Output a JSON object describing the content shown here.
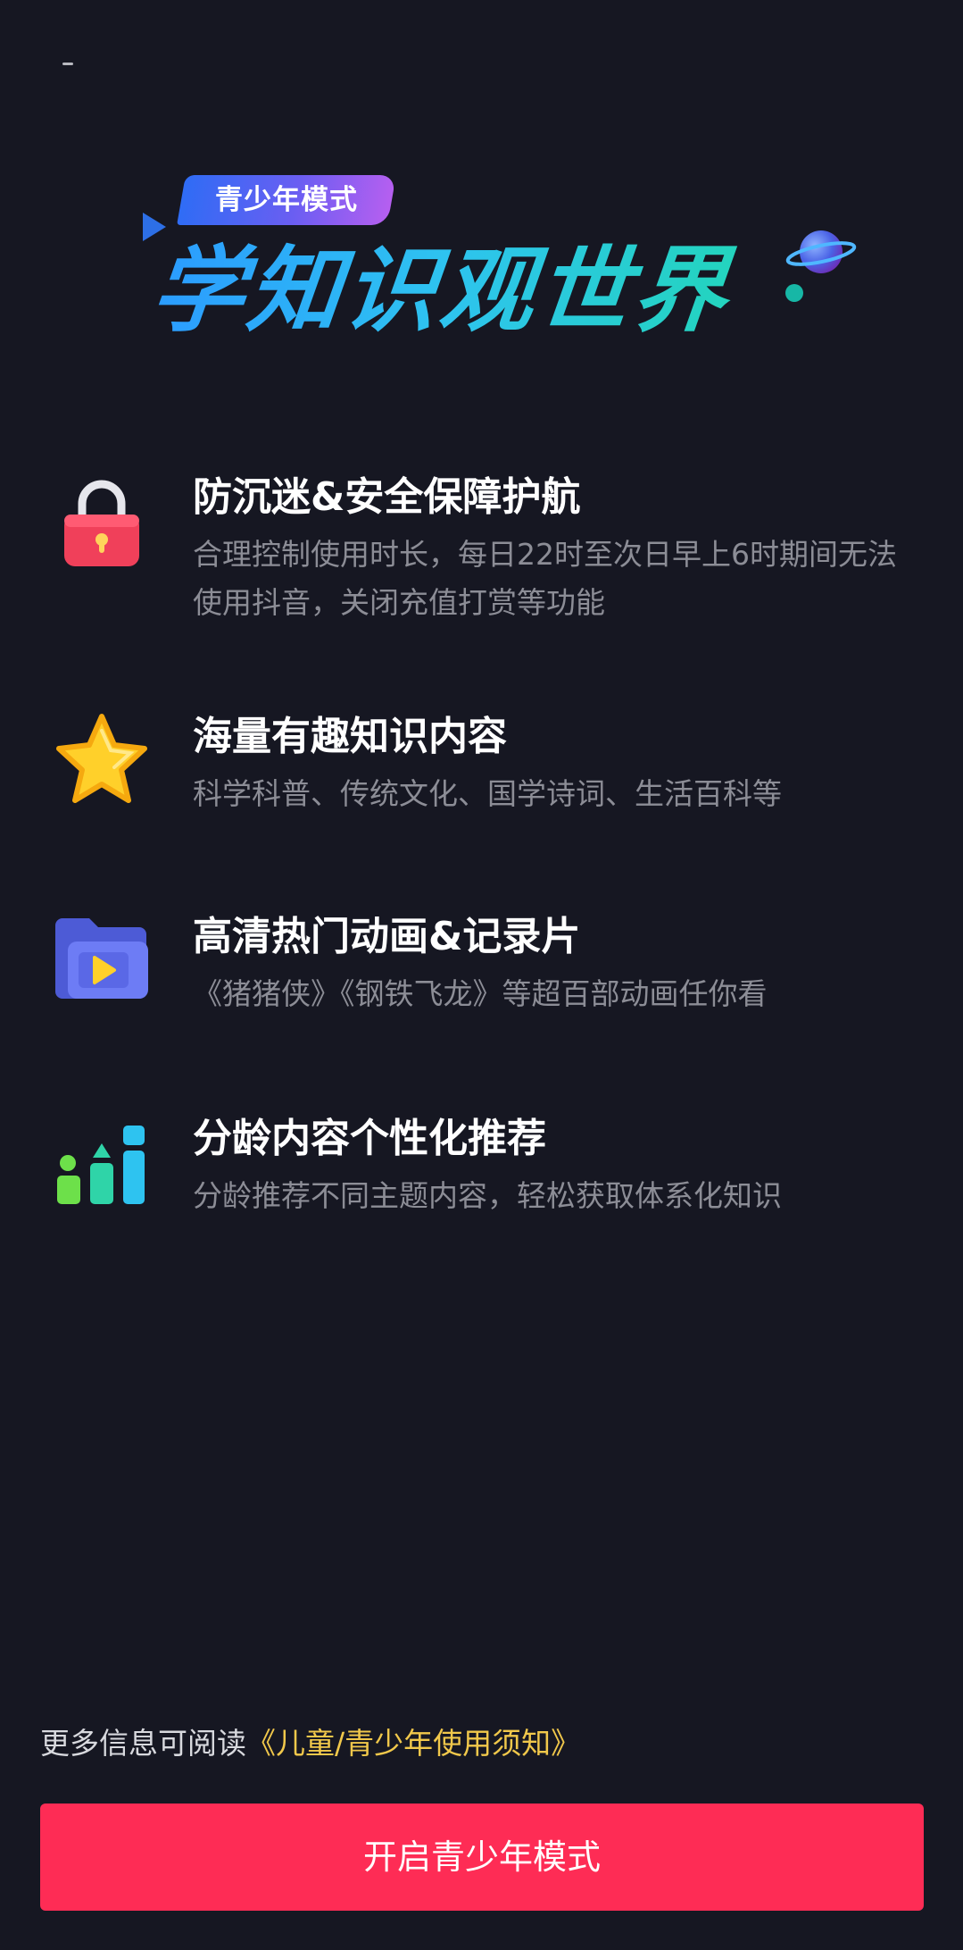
{
  "hero": {
    "badge": "青少年模式",
    "title": "学知识观世界"
  },
  "features": [
    {
      "icon": "lock-icon",
      "title": "防沉迷&安全保障护航",
      "desc": "合理控制使用时长，每日22时至次日早上6时期间无法使用抖音，关闭充值打赏等功能"
    },
    {
      "icon": "star-icon",
      "title": "海量有趣知识内容",
      "desc": "科学科普、传统文化、国学诗词、生活百科等"
    },
    {
      "icon": "video-folder-icon",
      "title": "高清热门动画&记录片",
      "desc": "《猪猪侠》《钢铁飞龙》等超百部动画任你看"
    },
    {
      "icon": "bar-chart-icon",
      "title": "分龄内容个性化推荐",
      "desc": "分龄推荐不同主题内容，轻松获取体系化知识"
    }
  ],
  "footer": {
    "notice_prefix": "更多信息可阅读",
    "notice_link": "《儿童/青少年使用须知》",
    "button_label": "开启青少年模式"
  },
  "colors": {
    "background": "#161722",
    "primary": "#fe2c55",
    "link": "#f1c84b",
    "title_gradient_start": "#2b9bff",
    "title_gradient_end": "#21d8b3"
  }
}
